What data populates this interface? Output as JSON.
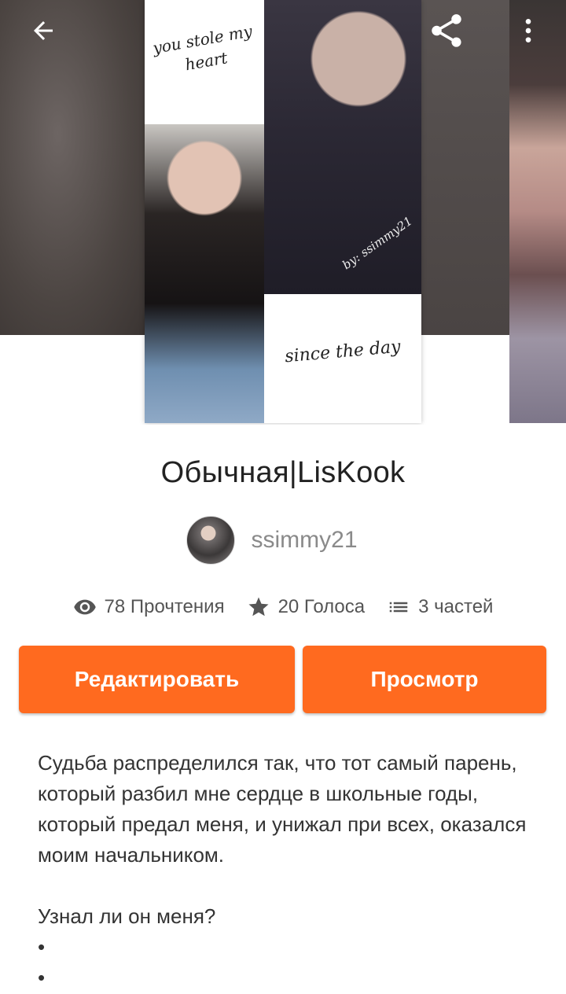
{
  "cover": {
    "text_top": "you stole my heart",
    "text_bottom": "since the day",
    "text_credit": "by: ssimmy21"
  },
  "story": {
    "title": "Обычная|LisKook",
    "author": "ssimmy21"
  },
  "stats": {
    "reads": "78 Прочтения",
    "votes": "20 Голоса",
    "parts": "3 частей"
  },
  "actions": {
    "edit_label": "Редактировать",
    "view_label": "Просмотр"
  },
  "description": {
    "paragraph1": "Судьба распределился так, что тот самый парень, который разбил мне сердце в школьные годы, который предал меня, и унижал при всех, оказался моим начальником.",
    "paragraph2": "Узнал ли он меня?",
    "bullets": [
      "•",
      "•"
    ]
  },
  "colors": {
    "accent": "#ff6a1f",
    "title": "#222222",
    "author": "#8a8a8a",
    "stats": "#555555"
  },
  "icons": {
    "back": "arrow-left-icon",
    "share": "share-icon",
    "more": "more-vertical-icon",
    "reads": "eye-icon",
    "votes": "star-icon",
    "parts": "list-icon"
  }
}
